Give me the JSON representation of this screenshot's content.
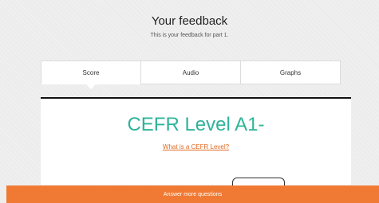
{
  "header": {
    "title": "Your feedback",
    "subtitle": "This is your feedback for part 1."
  },
  "tabs": [
    {
      "label": "Score",
      "active": true
    },
    {
      "label": "Audio",
      "active": false
    },
    {
      "label": "Graphs",
      "active": false
    }
  ],
  "score_panel": {
    "level": "CEFR Level A1-",
    "cefr_link": "What is a CEFR Level?"
  },
  "footer": {
    "button_label": "Answer more questions"
  },
  "colors": {
    "accent_teal": "#2fb39a",
    "link_orange": "#e06a22",
    "footer_orange": "#f07a33"
  }
}
